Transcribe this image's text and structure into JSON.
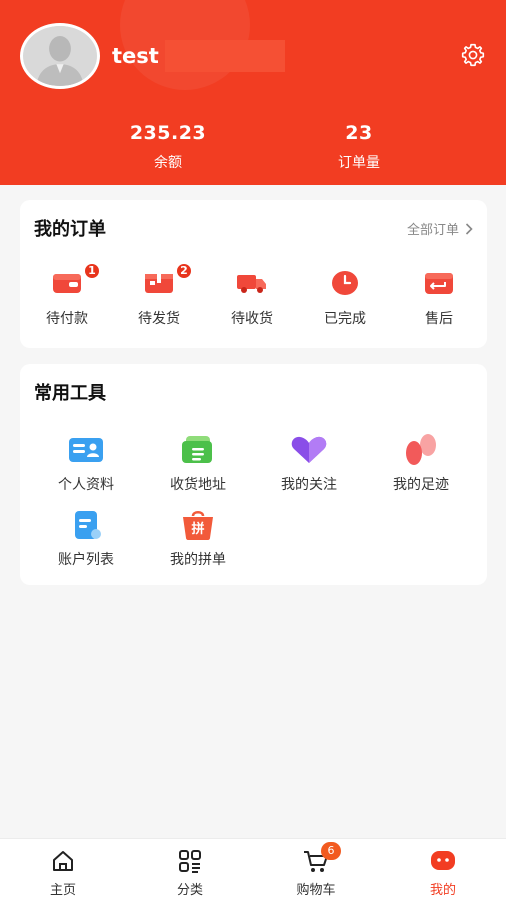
{
  "profile": {
    "username": "test",
    "balance_value": "235.23",
    "balance_label": "余额",
    "orders_value": "23",
    "orders_label": "订单量"
  },
  "orders_card": {
    "title": "我的订单",
    "all_link": "全部订单",
    "items": [
      {
        "label": "待付款",
        "icon": "wallet-icon",
        "badge": "1"
      },
      {
        "label": "待发货",
        "icon": "package-icon",
        "badge": "2"
      },
      {
        "label": "待收货",
        "icon": "truck-icon",
        "badge": ""
      },
      {
        "label": "已完成",
        "icon": "clock-icon",
        "badge": ""
      },
      {
        "label": "售后",
        "icon": "return-icon",
        "badge": ""
      }
    ]
  },
  "tools_card": {
    "title": "常用工具",
    "items": [
      {
        "label": "个人资料",
        "icon": "id-card-icon"
      },
      {
        "label": "收货地址",
        "icon": "address-icon"
      },
      {
        "label": "我的关注",
        "icon": "heart-icon"
      },
      {
        "label": "我的足迹",
        "icon": "footprint-icon"
      },
      {
        "label": "账户列表",
        "icon": "account-list-icon"
      },
      {
        "label": "我的拼单",
        "icon": "group-buy-icon"
      }
    ],
    "group_buy_glyph": "拼"
  },
  "tabbar": {
    "items": [
      {
        "label": "主页",
        "icon": "home-icon"
      },
      {
        "label": "分类",
        "icon": "category-icon"
      },
      {
        "label": "购物车",
        "icon": "cart-icon",
        "badge": "6"
      },
      {
        "label": "我的",
        "icon": "profile-icon"
      }
    ],
    "active": "我的"
  },
  "colors": {
    "brand": "#f23d22",
    "badge": "#e8341c",
    "tool_blue": "#3aa0f0",
    "tool_green": "#4cc04a",
    "tool_purple": "#8a4ee8",
    "tool_pink": "#f25a5a"
  }
}
